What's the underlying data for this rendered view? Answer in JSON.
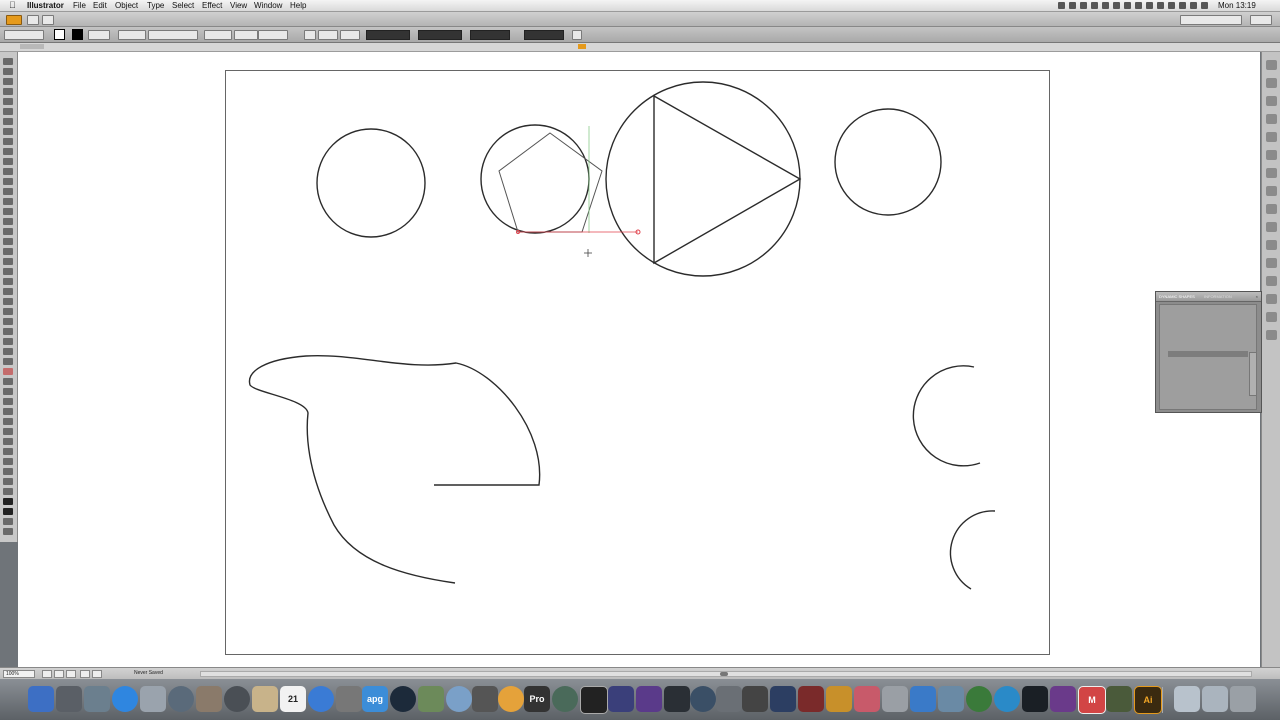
{
  "menubar": {
    "app_name": "Illustrator",
    "menus": [
      "File",
      "Edit",
      "Object",
      "Type",
      "Select",
      "Effect",
      "View",
      "Window",
      "Help"
    ],
    "clock": "Mon 13:19"
  },
  "panel": {
    "title": "DYNAMIC SHAPES",
    "tab2": "INFORMATION"
  },
  "statusbar": {
    "zoom": "100%",
    "status_text": "Never Saved"
  },
  "dock": {
    "icons": [
      "finder-icon",
      "launchpad-icon",
      "folder-icon",
      "app-store-icon",
      "preview-icon",
      "system-prefs-icon",
      "photos-icon",
      "disk-icon",
      "notes-icon",
      "calendar-icon",
      "itunes-icon",
      "utility-icon",
      "app-icon",
      "quicktime-icon",
      "iphoto-icon",
      "safari-icon",
      "photo-booth-icon",
      "pro-icon",
      "maps-icon",
      "aperture-icon",
      "bridge-icon",
      "motion-icon",
      "app2-icon",
      "compressor-icon",
      "app3-icon",
      "app4-icon",
      "app5-icon",
      "app6-icon",
      "app7-icon",
      "app8-icon",
      "app9-icon",
      "app10-icon",
      "app11-icon",
      "app12-icon",
      "app13-icon",
      "app14-icon",
      "app15-icon",
      "app16-icon",
      "app17-icon",
      "app18-icon",
      "app19-icon",
      "m-icon",
      "app20-icon",
      "illustrator-icon",
      "folder2-icon",
      "downloads-icon",
      "trash-icon"
    ],
    "calendar_day": "21",
    "pro_label": "Pro",
    "apg_label": "apg",
    "m_label": "M",
    "ai_label": "Ai"
  },
  "colors": {
    "stroke": "#2b2b2b",
    "guide_red": "#e0424c",
    "guide_green": "#7ac47a"
  }
}
